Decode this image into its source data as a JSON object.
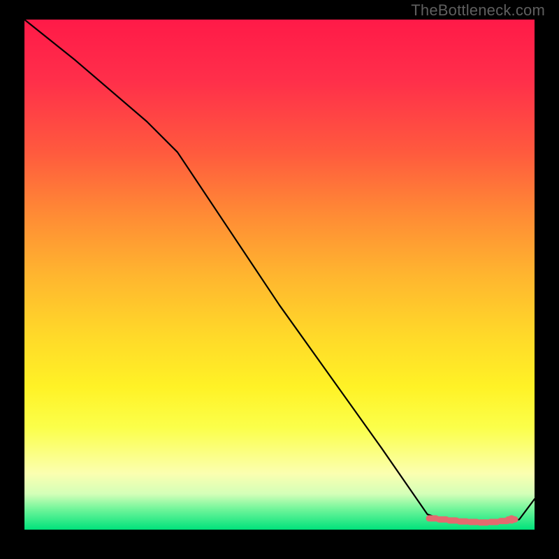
{
  "watermark": "TheBottleneck.com",
  "colors": {
    "background": "#000000",
    "curve": "#000000",
    "dash": "#e46a6f",
    "gradient_top": "#ff1a48",
    "gradient_mid": "#ffd929",
    "gradient_bottom": "#00e27b"
  },
  "chart_data": {
    "type": "line",
    "title": "",
    "xlabel": "",
    "ylabel": "",
    "xlim": [
      0,
      100
    ],
    "ylim": [
      0,
      100
    ],
    "series": [
      {
        "name": "bottleneck-curve",
        "x": [
          0,
          10,
          24,
          30,
          40,
          50,
          60,
          70,
          79,
          82,
          86,
          90,
          94,
          97,
          100
        ],
        "y": [
          100,
          92,
          80,
          74,
          59,
          44,
          30,
          16,
          3,
          2,
          1.5,
          1.3,
          1.5,
          2,
          6
        ]
      }
    ],
    "markers": {
      "name": "optimal-range-dashes",
      "x": [
        80,
        82,
        84,
        86,
        88,
        90,
        92,
        94,
        95.5
      ],
      "y": [
        2.2,
        2.0,
        1.8,
        1.6,
        1.5,
        1.4,
        1.5,
        1.7,
        2.0
      ]
    },
    "marker_dot": {
      "x": 95.5,
      "y": 2.0
    }
  }
}
